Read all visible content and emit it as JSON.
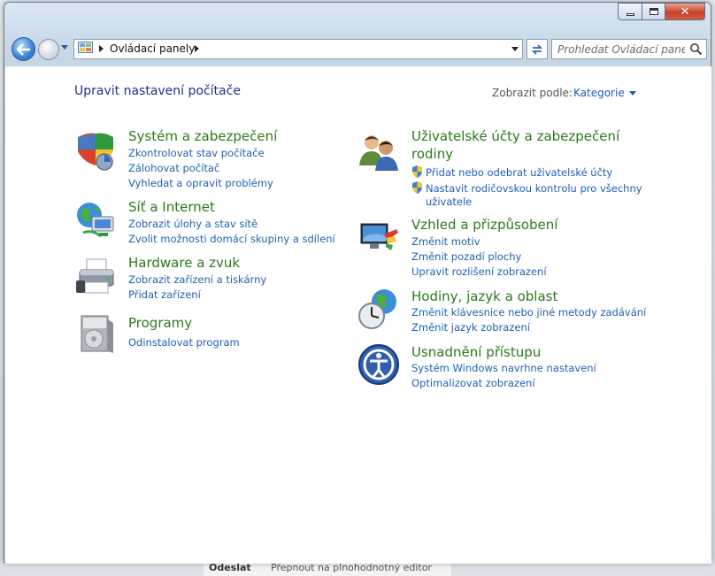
{
  "window": {
    "close_glyph": "✕"
  },
  "nav": {
    "address_segment": "Ovládací panely",
    "search_placeholder": "Prohledat Ovládací panely"
  },
  "main": {
    "title": "Upravit nastavení počítače",
    "view_by_label": "Zobrazit podle:",
    "view_by_value": "Kategorie"
  },
  "categories": {
    "system": {
      "title": "Systém a zabezpečení",
      "links": [
        "Zkontrolovat stav počítače",
        "Zálohovat počítač",
        "Vyhledat a opravit problémy"
      ]
    },
    "network": {
      "title": "Síť a Internet",
      "links": [
        "Zobrazit úlohy a stav sítě",
        "Zvolit možnosti domácí skupiny a sdílení"
      ]
    },
    "hardware": {
      "title": "Hardware a zvuk",
      "links": [
        "Zobrazit zařízení a tiskárny",
        "Přidat zařízení"
      ]
    },
    "programs": {
      "title": "Programy",
      "links": [
        "Odinstalovat program"
      ]
    },
    "users": {
      "title_line1": "Uživatelské účty a zabezpečení",
      "title_line2": "rodiny",
      "links": [
        "Přidat nebo odebrat uživatelské účty",
        "Nastavit rodičovskou kontrolu pro všechny",
        "uživatele"
      ]
    },
    "appearance": {
      "title": "Vzhled a přizpůsobení",
      "links": [
        "Změnit motiv",
        "Změnit pozadí plochy",
        "Upravit rozlišení zobrazení"
      ]
    },
    "clock": {
      "title": "Hodiny, jazyk a oblast",
      "links": [
        "Změnit klávesnice nebo jiné metody zadávání",
        "Změnit jazyk zobrazení"
      ]
    },
    "ease": {
      "title": "Usnadnění přístupu",
      "links": [
        "Systém Windows navrhne nastavení",
        "Optimalizovat zobrazení"
      ]
    }
  },
  "background": {
    "button1": "Odeslat",
    "button2": "Přepnout na plnohodnotný editor"
  }
}
